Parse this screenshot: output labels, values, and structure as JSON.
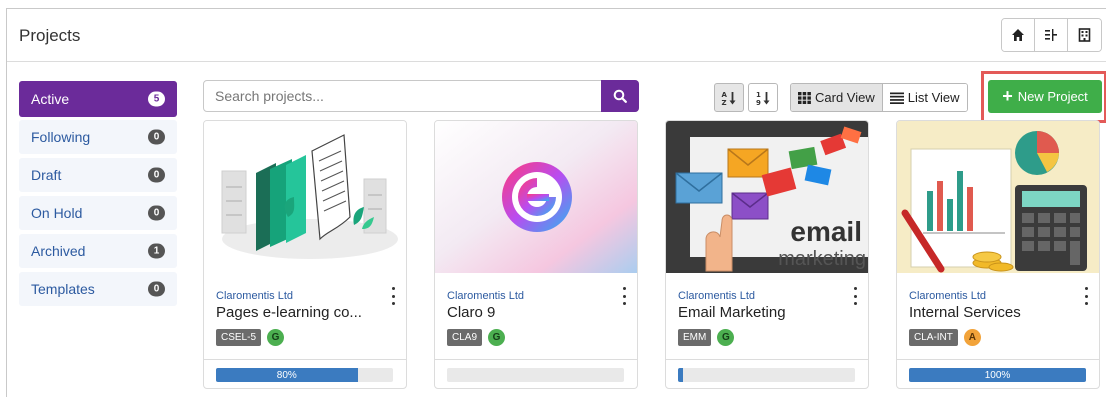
{
  "header": {
    "title": "Projects",
    "buttons": [
      {
        "icon": "home-icon"
      },
      {
        "icon": "hierarchy-icon"
      },
      {
        "icon": "building-icon"
      }
    ]
  },
  "sidebar": {
    "items": [
      {
        "label": "Active",
        "count": "5",
        "active": true
      },
      {
        "label": "Following",
        "count": "0"
      },
      {
        "label": "Draft",
        "count": "0"
      },
      {
        "label": "On Hold",
        "count": "0"
      },
      {
        "label": "Archived",
        "count": "1"
      },
      {
        "label": "Templates",
        "count": "0"
      }
    ]
  },
  "search": {
    "placeholder": "Search projects...",
    "value": ""
  },
  "toolbar": {
    "sort_az_label": "A Z",
    "sort_num_label": "1 9",
    "card_view_label": "Card View",
    "list_view_label": "List View",
    "new_project_label": "New Project"
  },
  "projects": [
    {
      "client": "Claromentis Ltd",
      "name": "Pages e-learning co...",
      "code": "CSEL-5",
      "avatar": "G",
      "avatar_color": "#4caf50",
      "progress_text": "80%",
      "progress": 0.8
    },
    {
      "client": "Claromentis Ltd",
      "name": "Claro 9",
      "code": "CLA9",
      "avatar": "G",
      "avatar_color": "#4caf50",
      "progress_text": "",
      "progress": 0
    },
    {
      "client": "Claromentis Ltd",
      "name": "Email Marketing",
      "code": "EMM",
      "avatar": "G",
      "avatar_color": "#4caf50",
      "progress_text": "",
      "progress": 0.03
    },
    {
      "client": "Claromentis Ltd",
      "name": "Internal Services",
      "code": "CLA-INT",
      "avatar": "A",
      "avatar_color": "#f2a33a",
      "progress_text": "100%",
      "progress": 1.0
    }
  ],
  "images": {
    "email_word": "email",
    "marketing_word": "marketing"
  },
  "colors": {
    "accent": "#6b2b9a",
    "primary_action": "#3fae49",
    "progress": "#3b7bc0",
    "highlight": "#e35a58"
  }
}
